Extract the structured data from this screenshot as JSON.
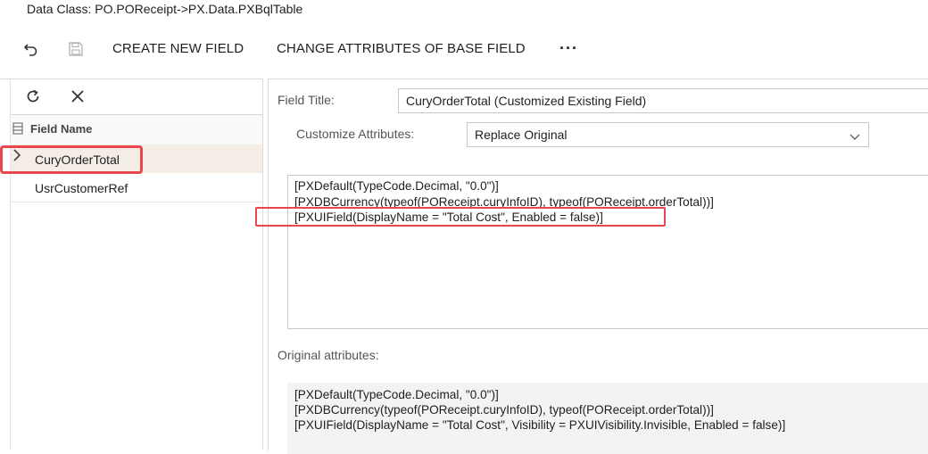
{
  "header": {
    "data_class": "Data Class: PO.POReceipt->PX.Data.PXBqlTable"
  },
  "toolbar": {
    "undo_icon": "undo-icon",
    "save_icon": "save-icon",
    "create_new_field": "CREATE NEW FIELD",
    "change_attributes": "CHANGE ATTRIBUTES OF BASE FIELD",
    "more": "···"
  },
  "left_panel": {
    "refresh_icon": "refresh-icon",
    "close_icon": "close-icon",
    "column_header": "Field Name",
    "rows": [
      {
        "label": "CuryOrderTotal",
        "selected": true
      },
      {
        "label": "UsrCustomerRef",
        "selected": false
      }
    ]
  },
  "form": {
    "field_title_label": "Field Title:",
    "field_title_value": "CuryOrderTotal (Customized Existing Field)",
    "customize_label": "Customize Attributes:",
    "customize_value": "Replace Original",
    "code_lines": [
      "[PXDefault(TypeCode.Decimal, \"0.0\")]",
      "[PXDBCurrency(typeof(POReceipt.curyInfoID), typeof(POReceipt.orderTotal))]",
      "[PXUIField(DisplayName = \"Total Cost\", Enabled = false)]"
    ],
    "original_label": "Original attributes:",
    "original_lines": [
      "[PXDefault(TypeCode.Decimal, \"0.0\")]",
      "[PXDBCurrency(typeof(POReceipt.curyInfoID), typeof(POReceipt.orderTotal))]",
      "[PXUIField(DisplayName = \"Total Cost\", Visibility = PXUIVisibility.Invisible, Enabled = false)]"
    ]
  },
  "colors": {
    "highlight": "#e9474f",
    "selected_row": "#f3ede6"
  }
}
